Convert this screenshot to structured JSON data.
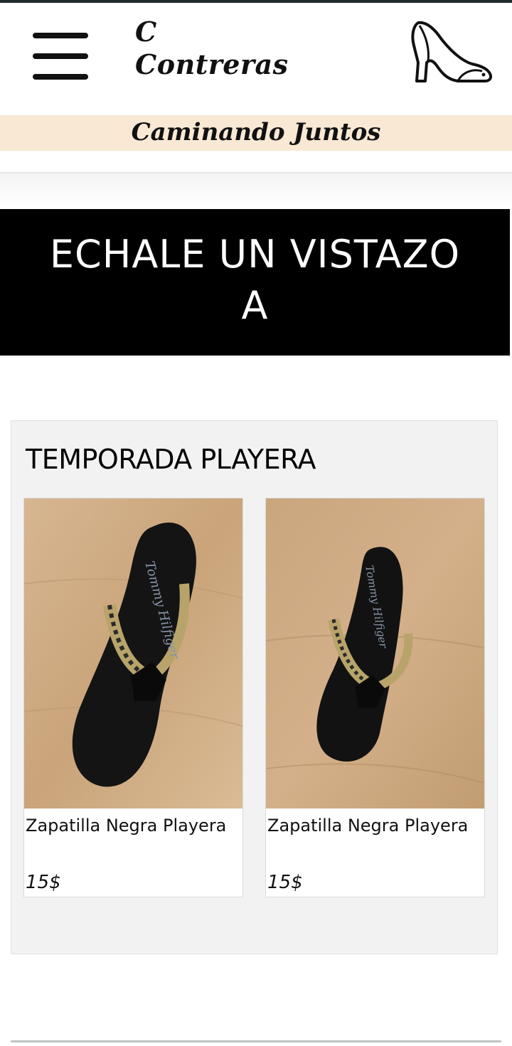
{
  "header": {
    "brand_line1": "C",
    "brand_line2": "Contreras",
    "menu_icon": "hamburger-menu-icon",
    "logo_icon": "high-heel-shoe-icon"
  },
  "tagline": "Caminando Juntos",
  "banner": {
    "line1": "ECHALE UN VISTAZO",
    "line2": "A"
  },
  "section": {
    "title": "TEMPORADA PLAYERA",
    "products": [
      {
        "name": "Zapatilla Negra Playera",
        "price": "15$",
        "image": "black-flip-flop-photo"
      },
      {
        "name": "Zapatilla Negra Playera",
        "price": "15$",
        "image": "black-flip-flop-photo"
      }
    ]
  },
  "colors": {
    "tagline_bg": "#f8e8d4",
    "banner_bg": "#000000",
    "section_bg": "#f2f2f2"
  }
}
